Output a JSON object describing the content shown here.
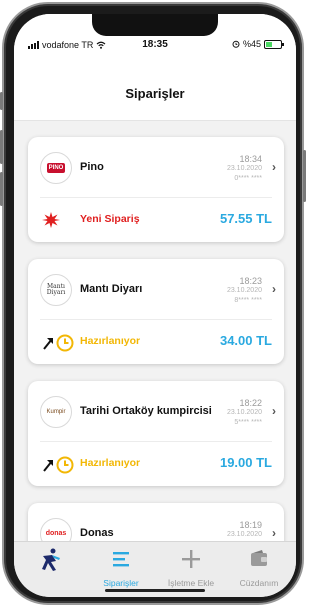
{
  "status_bar": {
    "carrier": "vodafone TR",
    "time": "18:35",
    "battery": "%45"
  },
  "header": {
    "title": "Siparişler"
  },
  "orders": [
    {
      "restaurant": "Pino",
      "logo_text": "PINO",
      "time": "18:34",
      "date": "23.10.2020",
      "masked": "0**** ****",
      "status": "Yeni Sipariş",
      "price": "57.55 TL"
    },
    {
      "restaurant": "Mantı Diyarı",
      "logo_text": "Mantı Diyarı",
      "time": "18:23",
      "date": "23.10.2020",
      "masked": "8**** ****",
      "status": "Hazırlanıyor",
      "price": "34.00 TL"
    },
    {
      "restaurant": "Tarihi Ortaköy kumpircisi",
      "logo_text": "Kumpir",
      "time": "18:22",
      "date": "23.10.2020",
      "masked": "5**** ****",
      "status": "Hazırlanıyor",
      "price": "19.00 TL"
    },
    {
      "restaurant": "Donas",
      "logo_text": "donas",
      "time": "18:19",
      "date": "23.10.2020"
    }
  ],
  "tabs": [
    {
      "label": "",
      "icon": "runner-icon"
    },
    {
      "label": "Siparişler",
      "icon": "menu-icon"
    },
    {
      "label": "İşletme Ekle",
      "icon": "plus-icon"
    },
    {
      "label": "Cüzdanım",
      "icon": "wallet-icon"
    }
  ],
  "colors": {
    "accent_blue": "#2aa9e0",
    "new_order_red": "#e02020",
    "preparing_yellow": "#f2b705"
  }
}
